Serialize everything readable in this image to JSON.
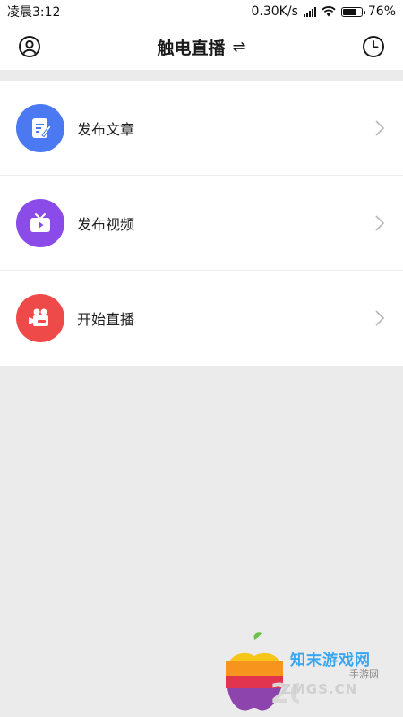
{
  "status_bar": {
    "time": "凌晨3:12",
    "network_speed": "0.30K/s",
    "battery_percent": "76%",
    "battery_level": 0.76
  },
  "nav": {
    "title": "触电直播",
    "swap_icon": "⇌",
    "left_icon": "user-icon",
    "right_icon": "clock-icon"
  },
  "menu": {
    "items": [
      {
        "label": "发布文章",
        "icon": "edit-article-icon",
        "color": "#4a79f2"
      },
      {
        "label": "发布视频",
        "icon": "tv-play-icon",
        "color": "#8b4be8"
      },
      {
        "label": "开始直播",
        "icon": "video-camera-icon",
        "color": "#ef4a4a"
      }
    ]
  },
  "watermark": {
    "text": "知末游戏网",
    "sub": "手游网",
    "url": "ZMGS.CN",
    "number": "265"
  },
  "colors": {
    "background": "#ebebeb",
    "surface": "#ffffff",
    "chevron": "#bbbbbb"
  }
}
